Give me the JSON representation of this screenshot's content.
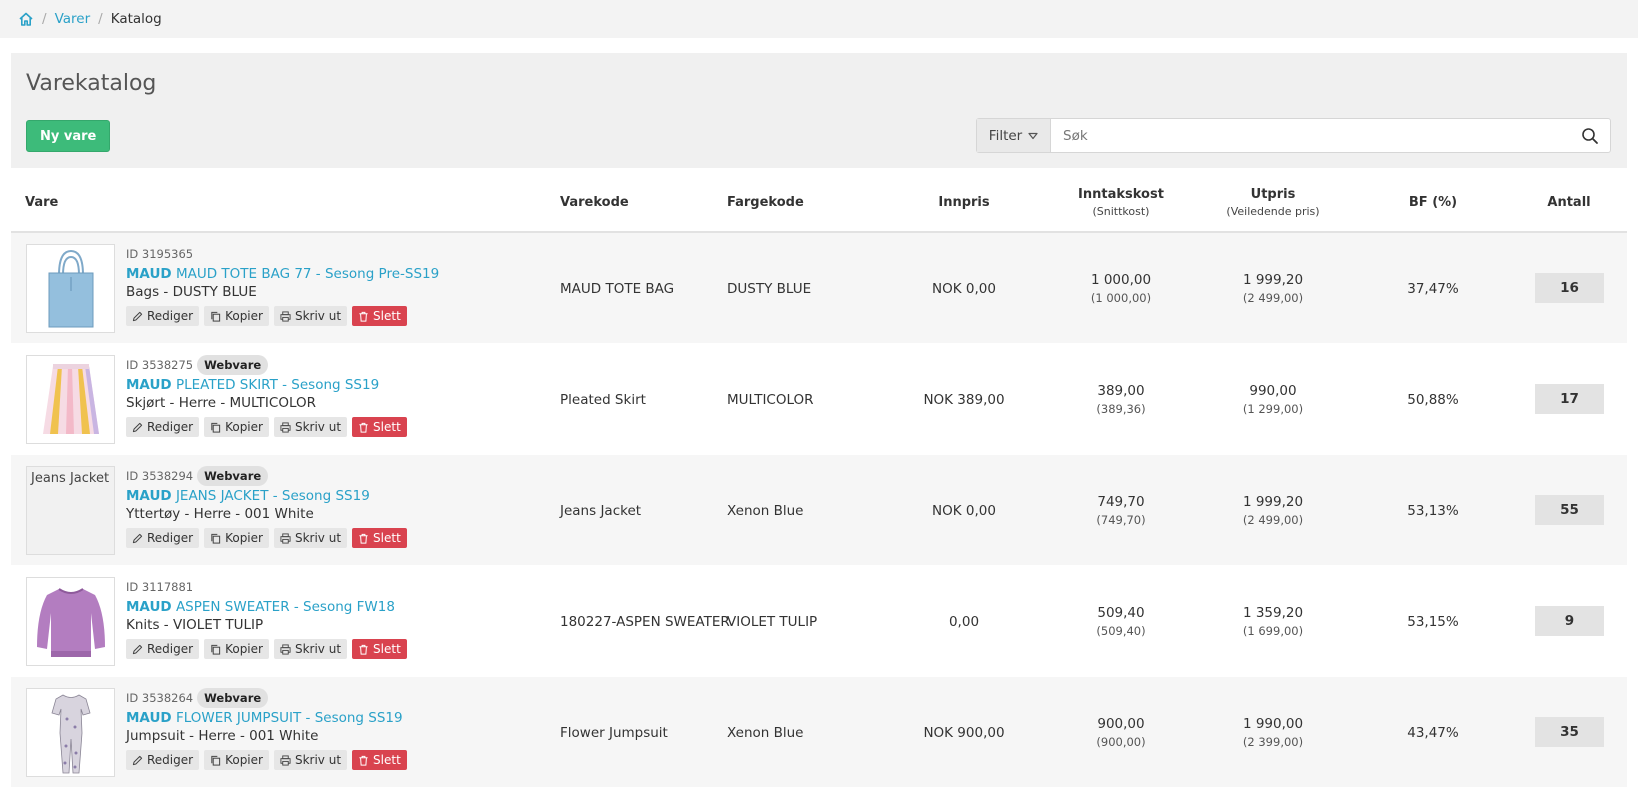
{
  "breadcrumb": {
    "home_icon": "home-icon",
    "items": [
      "Varer",
      "Katalog"
    ]
  },
  "page": {
    "title": "Varekatalog",
    "new_button": "Ny vare"
  },
  "search": {
    "filter_label": "Filter",
    "placeholder": "Søk"
  },
  "colors": {
    "accent": "#2aa1c8",
    "primary_button": "#3dbb7a",
    "danger": "#d9434f"
  },
  "table": {
    "headers": {
      "vare": "Vare",
      "varekode": "Varekode",
      "fargekode": "Fargekode",
      "innpris": "Innpris",
      "inntakskost": "Inntakskost",
      "inntakskost_sub": "(Snittkost)",
      "utpris": "Utpris",
      "utpris_sub": "(Veiledende pris)",
      "bf": "BF (%)",
      "antall": "Antall"
    },
    "actions": {
      "edit": "Rediger",
      "copy": "Kopier",
      "print": "Skriv ut",
      "delete": "Slett"
    },
    "rows": [
      {
        "id": "ID 3195365",
        "badge": "",
        "brand": "MAUD",
        "name": "MAUD TOTE BAG 77 - Sesong Pre-SS19",
        "category": "Bags - DUSTY BLUE",
        "image": "tote-bag",
        "image_alt": "",
        "varekode": "MAUD TOTE BAG",
        "fargekode": "DUSTY BLUE",
        "innpris": "NOK 0,00",
        "inntakskost": "1 000,00",
        "snittkost": "(1 000,00)",
        "utpris": "1 999,20",
        "veiledende": "(2 499,00)",
        "bf": "37,47%",
        "antall": "16"
      },
      {
        "id": "ID 3538275",
        "badge": "Webvare",
        "brand": "MAUD",
        "name": "PLEATED SKIRT - Sesong SS19",
        "category": "Skjørt - Herre - MULTICOLOR",
        "image": "skirt",
        "image_alt": "",
        "varekode": "Pleated Skirt",
        "fargekode": "MULTICOLOR",
        "innpris": "NOK 389,00",
        "inntakskost": "389,00",
        "snittkost": "(389,36)",
        "utpris": "990,00",
        "veiledende": "(1 299,00)",
        "bf": "50,88%",
        "antall": "17"
      },
      {
        "id": "ID 3538294",
        "badge": "Webvare",
        "brand": "MAUD",
        "name": "JEANS JACKET - Sesong SS19",
        "category": "Yttertøy - Herre - 001 White",
        "image": "broken",
        "image_alt": "Jeans Jacket",
        "varekode": "Jeans Jacket",
        "fargekode": "Xenon Blue",
        "innpris": "NOK 0,00",
        "inntakskost": "749,70",
        "snittkost": "(749,70)",
        "utpris": "1 999,20",
        "veiledende": "(2 499,00)",
        "bf": "53,13%",
        "antall": "55"
      },
      {
        "id": "ID 3117881",
        "badge": "",
        "brand": "MAUD",
        "name": "ASPEN SWEATER - Sesong FW18",
        "category": "Knits - VIOLET TULIP",
        "image": "sweater",
        "image_alt": "",
        "varekode": "180227-ASPEN SWEATER",
        "fargekode": "VIOLET TULIP",
        "innpris": "0,00",
        "inntakskost": "509,40",
        "snittkost": "(509,40)",
        "utpris": "1 359,20",
        "veiledende": "(1 699,00)",
        "bf": "53,15%",
        "antall": "9"
      },
      {
        "id": "ID 3538264",
        "badge": "Webvare",
        "brand": "MAUD",
        "name": "FLOWER JUMPSUIT - Sesong SS19",
        "category": "Jumpsuit - Herre - 001 White",
        "image": "jumpsuit",
        "image_alt": "",
        "varekode": "Flower Jumpsuit",
        "fargekode": "Xenon Blue",
        "innpris": "NOK 900,00",
        "inntakskost": "900,00",
        "snittkost": "(900,00)",
        "utpris": "1 990,00",
        "veiledende": "(2 399,00)",
        "bf": "43,47%",
        "antall": "35"
      }
    ]
  }
}
